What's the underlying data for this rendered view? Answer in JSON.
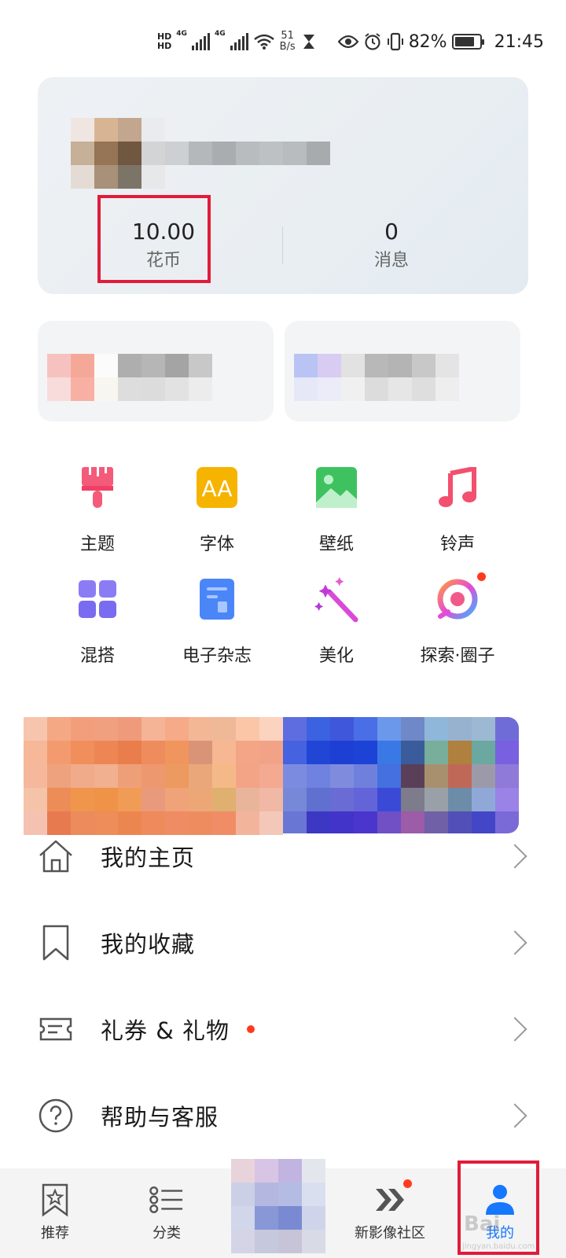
{
  "status_bar": {
    "hd1": "HD",
    "hd2": "HD",
    "net1": "4G",
    "net2": "4G",
    "speed_value": "51",
    "speed_unit": "B/s",
    "battery_percent": "82%",
    "battery_level": 0.82,
    "time": "21:45"
  },
  "profile": {
    "coins_value": "10.00",
    "coins_label": "花币",
    "messages_value": "0",
    "messages_label": "消息"
  },
  "grid": [
    {
      "label": "主题",
      "icon": "theme-brush-icon"
    },
    {
      "label": "字体",
      "icon": "font-icon"
    },
    {
      "label": "壁纸",
      "icon": "wallpaper-icon"
    },
    {
      "label": "铃声",
      "icon": "music-note-icon"
    },
    {
      "label": "混搭",
      "icon": "mix-grid-icon"
    },
    {
      "label": "电子杂志",
      "icon": "magazine-icon"
    },
    {
      "label": "美化",
      "icon": "magic-wand-icon"
    },
    {
      "label": "探索·圈子",
      "icon": "explore-circle-icon"
    }
  ],
  "list": [
    {
      "label": "我的主页",
      "icon": "home-icon"
    },
    {
      "label": "我的收藏",
      "icon": "bookmark-icon"
    },
    {
      "label": "礼券 & 礼物",
      "icon": "ticket-icon"
    },
    {
      "label": "帮助与客服",
      "icon": "help-icon"
    }
  ],
  "bottom_nav": [
    {
      "label": "推荐",
      "icon": "star-bookmark-icon"
    },
    {
      "label": "分类",
      "icon": "category-list-icon"
    },
    {
      "label": "",
      "icon": "blurred-center-icon"
    },
    {
      "label": "新影像社区",
      "icon": "chevrons-icon"
    },
    {
      "label": "我的",
      "icon": "person-icon"
    }
  ],
  "watermark": {
    "text": "Bai",
    "sub": "jingyan.baidu.com"
  },
  "colors": {
    "accent": "#1677ff",
    "highlight": "#e21b3a",
    "badge": "#ff3b1f",
    "theme_pink": "#f45a7a",
    "font_yellow": "#f6b300",
    "wallpaper_green": "#3ec25f",
    "mix_purple": "#7a6cf0",
    "magazine_blue": "#4a86f7"
  }
}
